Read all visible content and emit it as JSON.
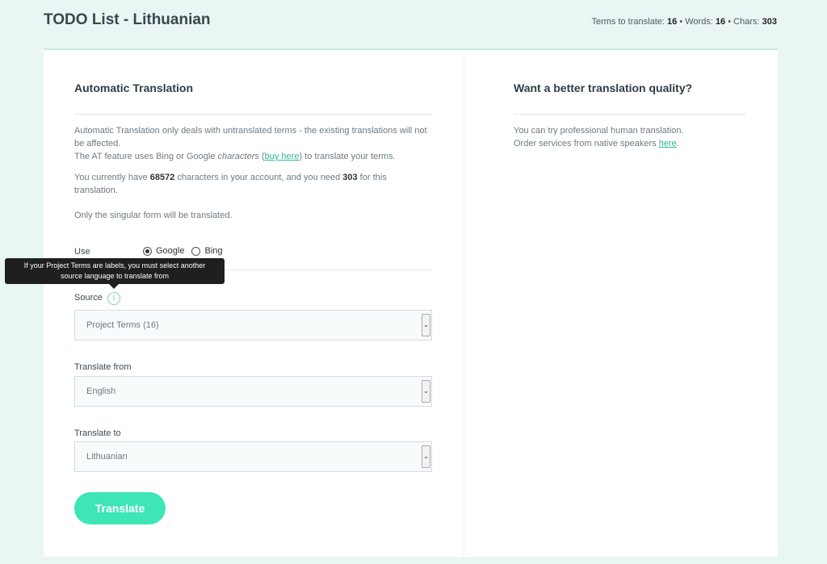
{
  "header": {
    "title": "TODO List - Lithuanian",
    "stats": {
      "terms_label": "Terms to translate:",
      "terms_value": "16",
      "words_label": "Words:",
      "words_value": "16",
      "chars_label": "Chars:",
      "chars_value": "303",
      "separator": "•"
    }
  },
  "left": {
    "title": "Automatic Translation",
    "intro_line1": "Automatic Translation only deals with untranslated terms - the existing translations will not",
    "intro_line2": "be affected.",
    "intro_line3_a": "The AT feature uses Bing or Google ",
    "intro_line3_em": "characters",
    "intro_line3_b": " (",
    "buy_link": "buy here",
    "intro_line3_c": ") to translate your terms.",
    "balance_a": "You currently have ",
    "balance_chars": "68572",
    "balance_b": " characters in your account, and you need ",
    "needed_chars": "303",
    "balance_c": " for this",
    "balance_line2": "translation.",
    "singular_note": "Only the singular form will be translated.",
    "use_label": "Use",
    "engines": [
      {
        "label": "Google",
        "checked": true
      },
      {
        "label": "Bing",
        "checked": false
      }
    ],
    "tooltip_line1": "If your Project Terms are labels, you must select another",
    "tooltip_line2": "source language to translate from",
    "source_label": "Source",
    "source_value": "Project Terms (16)",
    "from_label": "Translate from",
    "from_value": "English",
    "to_label": "Translate to",
    "to_value": "Lithuanian",
    "translate_button": "Translate"
  },
  "right": {
    "title": "Want a better translation quality?",
    "line1": "You can try professional human translation.",
    "line2": "Order services from native speakers ",
    "here_link": "here",
    "line2_end": "."
  }
}
